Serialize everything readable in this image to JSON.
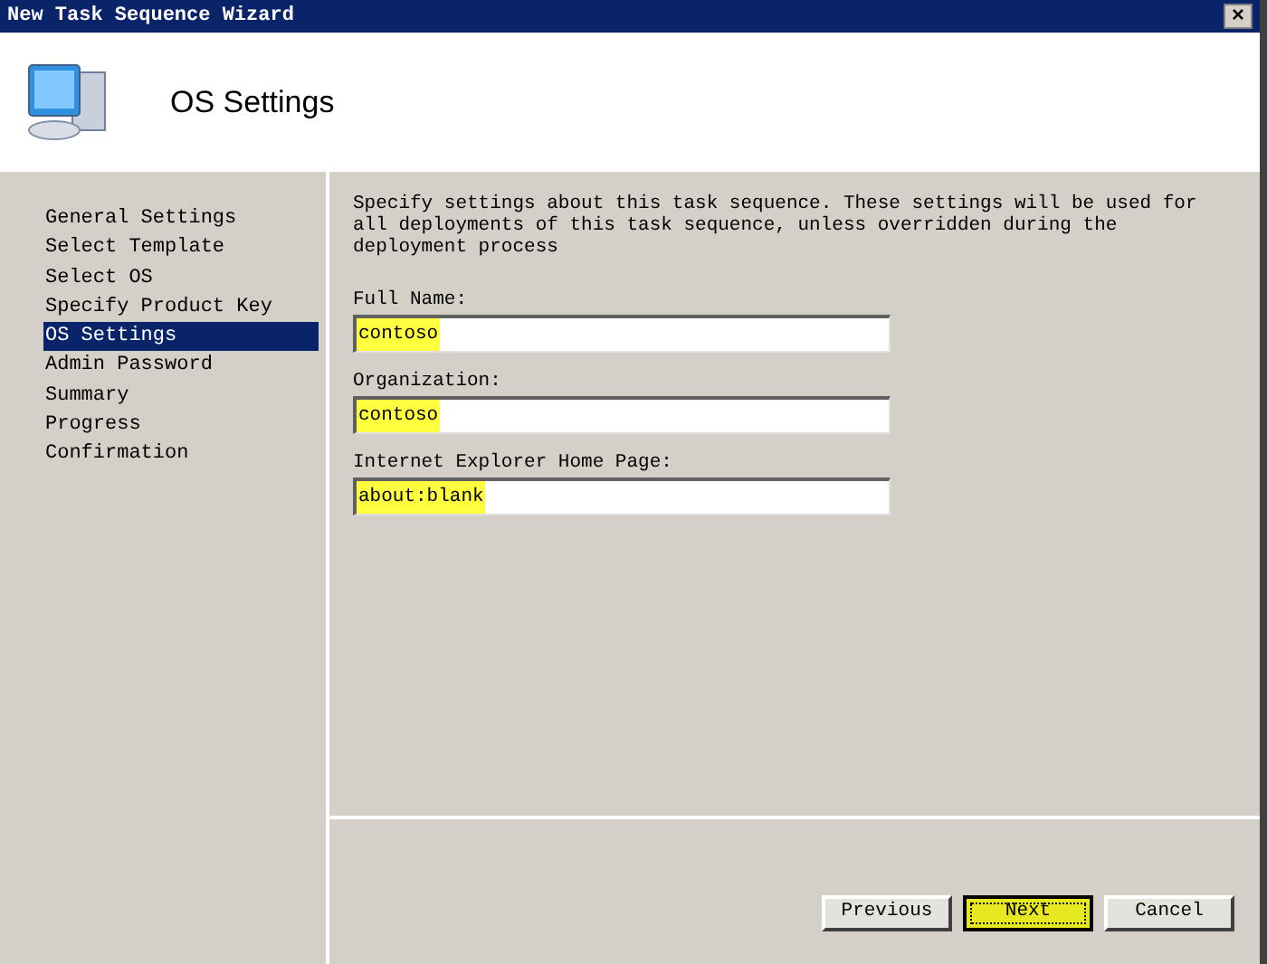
{
  "window": {
    "title": "New Task Sequence Wizard",
    "close": "×"
  },
  "header": {
    "title": "OS Settings"
  },
  "sidebar": {
    "items": [
      {
        "label": "General Settings",
        "selected": false
      },
      {
        "label": "Select Template",
        "selected": false
      },
      {
        "label": "Select OS",
        "selected": false
      },
      {
        "label": "Specify Product Key",
        "selected": false
      },
      {
        "label": "OS Settings",
        "selected": true
      },
      {
        "label": "Admin Password",
        "selected": false
      },
      {
        "label": "Summary",
        "selected": false
      },
      {
        "label": "Progress",
        "selected": false
      },
      {
        "label": "Confirmation",
        "selected": false
      }
    ]
  },
  "description": "Specify settings about this task sequence.  These settings will be used for all deployments of this task sequence, unless overridden during the deployment process",
  "fields": [
    {
      "label": "Full Name:",
      "value": "contoso",
      "highlighted": true
    },
    {
      "label": "Organization:",
      "value": "contoso",
      "highlighted": true
    },
    {
      "label": "Internet Explorer Home Page:",
      "value": "about:blank",
      "highlighted": true
    }
  ],
  "buttons": [
    {
      "label": "Previous",
      "highlighted": false
    },
    {
      "label": "Next",
      "highlighted": true
    },
    {
      "label": "Cancel",
      "highlighted": false
    }
  ]
}
